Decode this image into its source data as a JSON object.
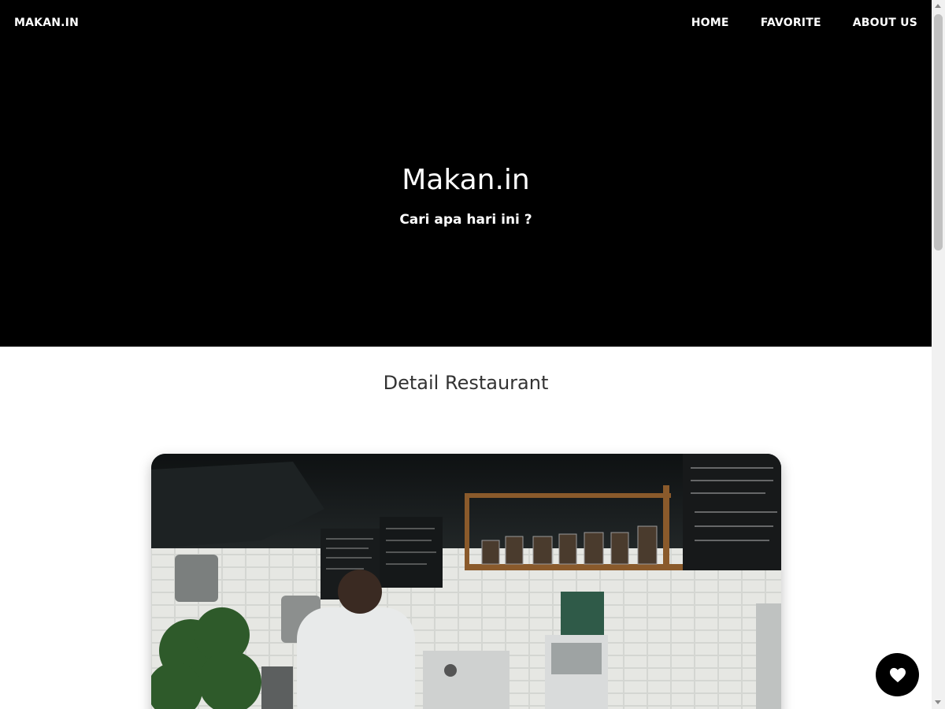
{
  "navbar": {
    "brand": "MAKAN.IN",
    "links": [
      "HOME",
      "FAVORITE",
      "ABOUT US"
    ]
  },
  "hero": {
    "title": "Makan.in",
    "subtitle": "Cari apa hari ini ?"
  },
  "detail": {
    "section_title": "Detail Restaurant",
    "image_icon": "restaurant-photo"
  },
  "favorite_button": {
    "icon": "heart-icon"
  },
  "colors": {
    "header_bg": "#000000",
    "header_text": "#ffffff",
    "section_title": "#333333",
    "fab_bg": "#000000"
  }
}
